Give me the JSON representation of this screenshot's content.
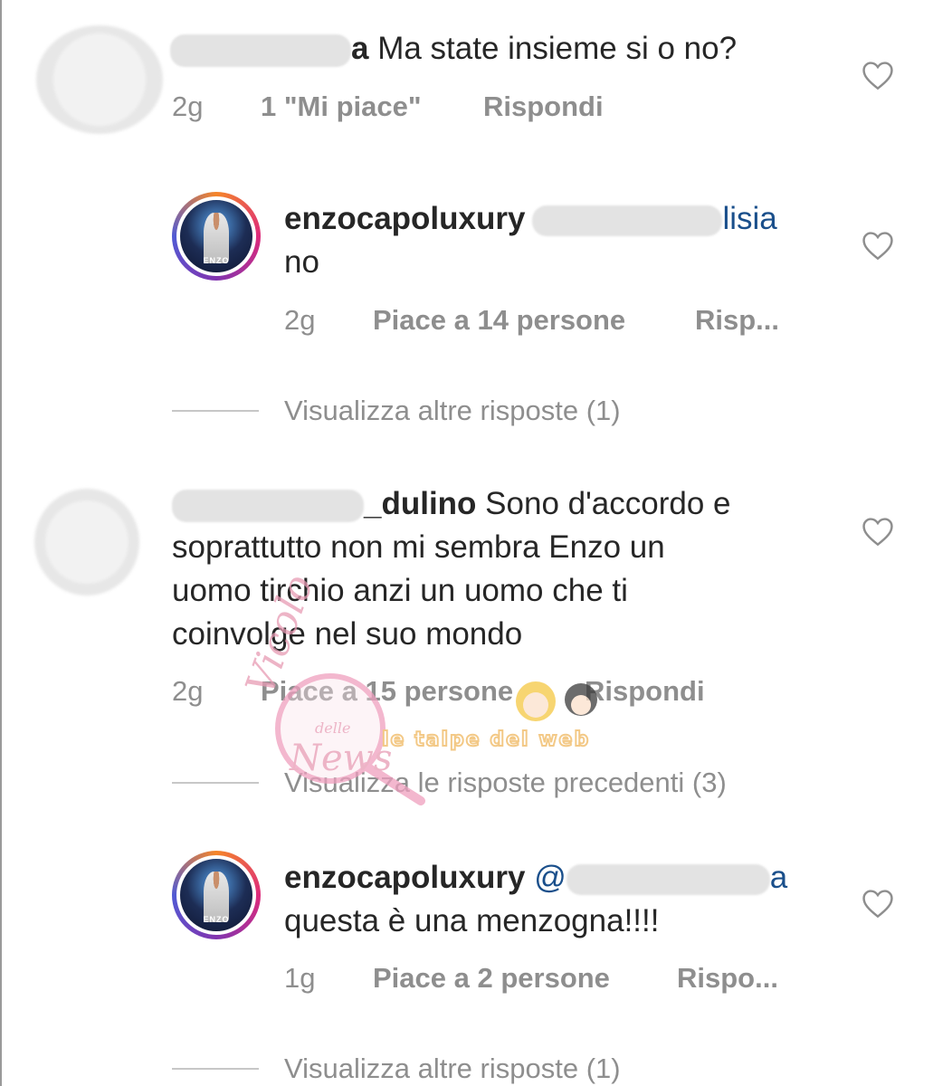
{
  "comments": [
    {
      "username_visible": "a",
      "text": "Ma state insieme si o no?",
      "time": "2g",
      "likes": "1 \"Mi piace\"",
      "reply": "Rispondi"
    },
    {
      "username": "enzocapoluxury",
      "mention_tail": "lisia",
      "text": "no",
      "time": "2g",
      "likes": "Piace a 14 persone",
      "reply": "Risp..."
    },
    {
      "view_more": "Visualizza altre risposte (1)"
    },
    {
      "username_visible": "_dulino",
      "text_line1": "Sono d'accordo e",
      "text_line2": "soprattutto non mi sembra Enzo un",
      "text_line3": "uomo tirchio anzi un uomo che ti",
      "text_line4": "coinvolge nel suo mondo",
      "time": "2g",
      "likes": "Piace a 15 persone",
      "reply": "Rispondi"
    },
    {
      "view_previous": "Visualizza le risposte precedenti (3)"
    },
    {
      "username": "enzocapoluxury",
      "mention_head": "@",
      "mention_tail": "a",
      "text": "questa è una menzogna!!!!",
      "time": "1g",
      "likes": "Piace a 2 persone",
      "reply": "Rispo..."
    },
    {
      "view_more": "Visualizza altre risposte (1)"
    }
  ],
  "avatar_label": "ENZO",
  "watermark": {
    "script_top": "Vicolo",
    "script_small": "delle",
    "script_bottom": "News",
    "banner": "le talpe del web"
  },
  "icons": {
    "like": "heart-icon"
  },
  "colors": {
    "meta": "#8e8e8e",
    "text": "#262626",
    "mention": "#1a4f8b"
  }
}
